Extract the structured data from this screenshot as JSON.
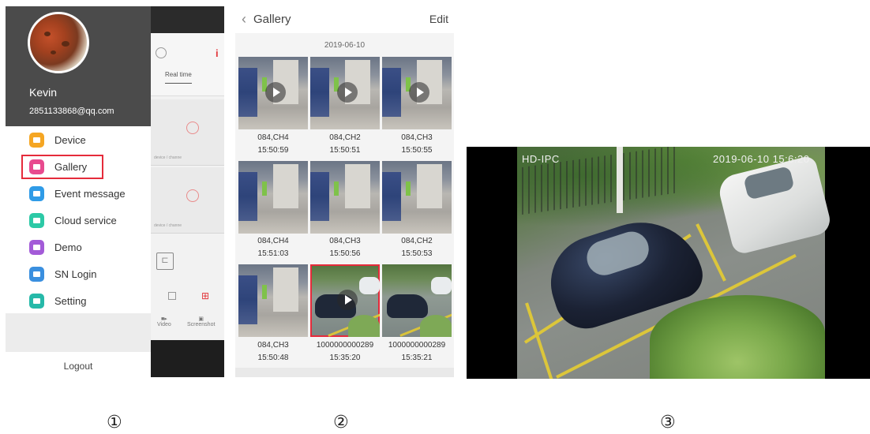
{
  "drawer": {
    "user_name": "Kevin",
    "email": "2851133868@qq.com",
    "menu": [
      {
        "label": "Device",
        "icon": "device-icon",
        "color": "#f5a623"
      },
      {
        "label": "Gallery",
        "icon": "gallery-icon",
        "color": "#e84a8e"
      },
      {
        "label": "Event message",
        "icon": "event-message-icon",
        "color": "#2f9be7"
      },
      {
        "label": "Cloud service",
        "icon": "cloud-icon",
        "color": "#2cc9a6"
      },
      {
        "label": "Demo",
        "icon": "demo-icon",
        "color": "#a35bd8"
      },
      {
        "label": "SN Login",
        "icon": "sn-login-icon",
        "color": "#3a8fdf"
      },
      {
        "label": "Setting",
        "icon": "setting-icon",
        "color": "#26b9a9"
      }
    ],
    "logout": "Logout",
    "background_tab": "Real time",
    "background_tools": [
      "Video",
      "Screenshot"
    ],
    "highlight_color": "#e52b3b"
  },
  "gallery": {
    "back_icon": "chevron-left-icon",
    "title": "Gallery",
    "edit": "Edit",
    "date": "2019-06-10",
    "items": [
      {
        "name": "084,CH4",
        "time": "15:50:59",
        "video": true,
        "scene": "indoor"
      },
      {
        "name": "084,CH2",
        "time": "15:50:51",
        "video": true,
        "scene": "indoor"
      },
      {
        "name": "084,CH3",
        "time": "15:50:55",
        "video": true,
        "scene": "indoor"
      },
      {
        "name": "084,CH4",
        "time": "15:51:03",
        "video": false,
        "scene": "indoor"
      },
      {
        "name": "084,CH3",
        "time": "15:50:56",
        "video": false,
        "scene": "indoor"
      },
      {
        "name": "084,CH2",
        "time": "15:50:53",
        "video": false,
        "scene": "indoor"
      },
      {
        "name": "084,CH3",
        "time": "15:50:48",
        "video": false,
        "scene": "indoor"
      },
      {
        "name": "1000000000289",
        "time": "15:35:20",
        "video": true,
        "scene": "outdoor",
        "selected": true
      },
      {
        "name": "1000000000289",
        "time": "15:35:21",
        "video": false,
        "scene": "outdoor"
      }
    ]
  },
  "player": {
    "osd_left": "HD-IPC",
    "osd_right": "2019-06-10  15:6:20"
  },
  "panel_numbers": [
    "①",
    "②",
    "③"
  ]
}
